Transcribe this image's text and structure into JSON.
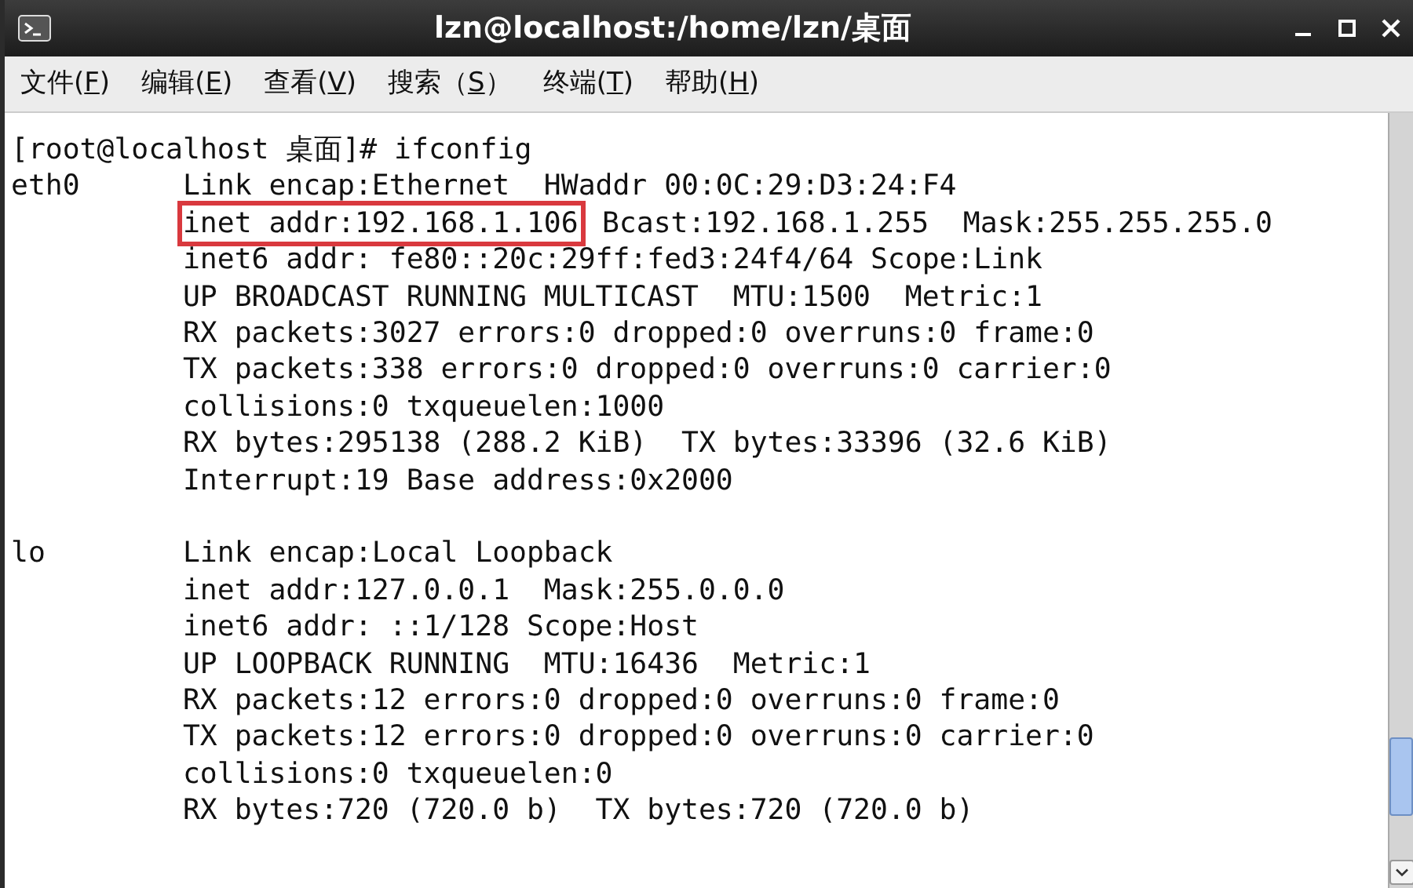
{
  "window": {
    "title": "lzn@localhost:/home/lzn/桌面"
  },
  "menu": [
    {
      "before": "文件(",
      "key": "F",
      "after": ")"
    },
    {
      "before": "编辑(",
      "key": "E",
      "after": ")"
    },
    {
      "before": "查看(",
      "key": "V",
      "after": ")"
    },
    {
      "before": "搜索（",
      "key": "S",
      "after": "）"
    },
    {
      "before": "终端(",
      "key": "T",
      "after": ")"
    },
    {
      "before": "帮助(",
      "key": "H",
      "after": ")"
    }
  ],
  "terminal": {
    "prompt": "[root@localhost 桌面]# ifconfig",
    "blocks": [
      {
        "interface": "eth0",
        "lines": [
          [
            {
              "text": "Link encap:Ethernet  HWaddr 00:0C:29:D3:24:F4",
              "boxed": false
            }
          ],
          [
            {
              "text": "inet addr:192.168.1.106",
              "boxed": true
            },
            {
              "text": "Bcast:192.168.1.255  Mask:255.255.255.0",
              "boxed": false
            }
          ],
          [
            {
              "text": "inet6 addr: fe80::20c:29ff:fed3:24f4/64 Scope:Link",
              "boxed": false
            }
          ],
          [
            {
              "text": "UP BROADCAST RUNNING MULTICAST  MTU:1500  Metric:1",
              "boxed": false
            }
          ],
          [
            {
              "text": "RX packets:3027 errors:0 dropped:0 overruns:0 frame:0",
              "boxed": false
            }
          ],
          [
            {
              "text": "TX packets:338 errors:0 dropped:0 overruns:0 carrier:0",
              "boxed": false
            }
          ],
          [
            {
              "text": "collisions:0 txqueuelen:1000",
              "boxed": false
            }
          ],
          [
            {
              "text": "RX bytes:295138 (288.2 KiB)  TX bytes:33396 (32.6 KiB)",
              "boxed": false
            }
          ],
          [
            {
              "text": "Interrupt:19 Base address:0x2000",
              "boxed": false
            }
          ]
        ]
      },
      {
        "interface": "lo",
        "lines": [
          [
            {
              "text": "Link encap:Local Loopback",
              "boxed": false
            }
          ],
          [
            {
              "text": "inet addr:127.0.0.1  Mask:255.0.0.0",
              "boxed": false
            }
          ],
          [
            {
              "text": "inet6 addr: ::1/128 Scope:Host",
              "boxed": false
            }
          ],
          [
            {
              "text": "UP LOOPBACK RUNNING  MTU:16436  Metric:1",
              "boxed": false
            }
          ],
          [
            {
              "text": "RX packets:12 errors:0 dropped:0 overruns:0 frame:0",
              "boxed": false
            }
          ],
          [
            {
              "text": "TX packets:12 errors:0 dropped:0 overruns:0 carrier:0",
              "boxed": false
            }
          ],
          [
            {
              "text": "collisions:0 txqueuelen:0",
              "boxed": false
            }
          ],
          [
            {
              "text": "RX bytes:720 (720.0 b)  TX bytes:720 (720.0 b)",
              "boxed": false
            }
          ]
        ]
      }
    ]
  }
}
